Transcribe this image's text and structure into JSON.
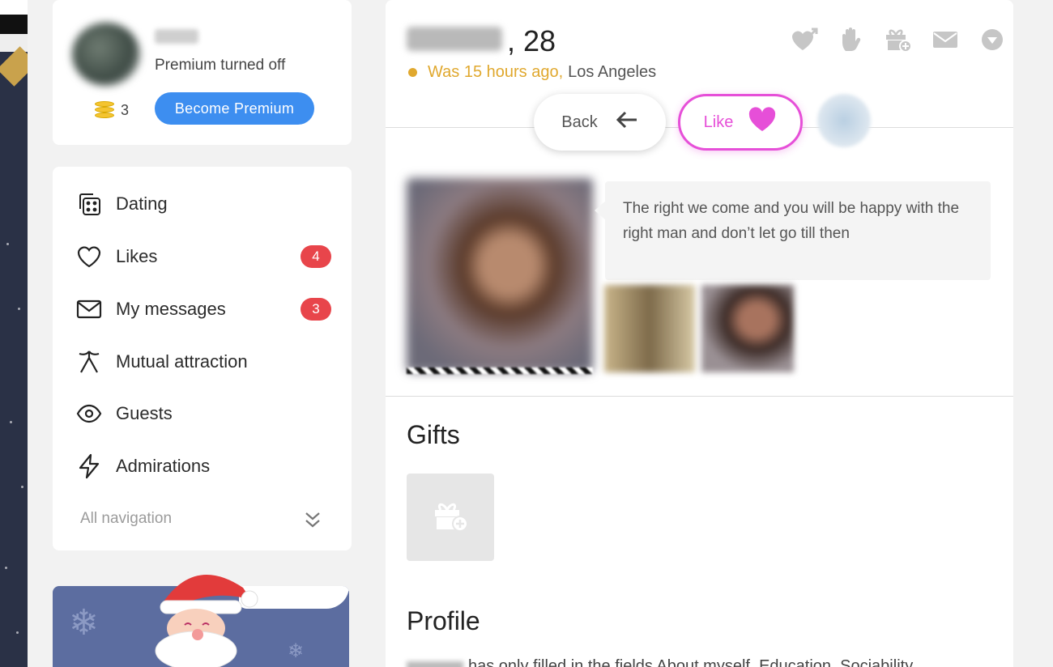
{
  "user": {
    "premium_status": "Premium turned off",
    "coins": "3",
    "become_premium_label": "Become Premium"
  },
  "nav": {
    "items": [
      {
        "label": "Dating",
        "icon": "dating-icon",
        "badge": ""
      },
      {
        "label": "Likes",
        "icon": "heart-icon",
        "badge": "4"
      },
      {
        "label": "My messages",
        "icon": "envelope-icon",
        "badge": "3"
      },
      {
        "label": "Mutual attraction",
        "icon": "mutual-attraction-icon",
        "badge": ""
      },
      {
        "label": "Guests",
        "icon": "eye-icon",
        "badge": ""
      },
      {
        "label": "Admirations",
        "icon": "lightning-icon",
        "badge": ""
      }
    ],
    "all_navigation_label": "All navigation"
  },
  "profile": {
    "age_suffix": ", 28",
    "last_seen": "Was 15 hours ago,",
    "city": "Los Angeles",
    "back_label": "Back",
    "like_label": "Like",
    "bio": "The right we come and you will be happy with the right man and don’t let go till then",
    "gifts_title": "Gifts",
    "profile_title": "Profile",
    "profile_text": "has only filled in the fields About myself, Education, Sociability"
  },
  "colors": {
    "accent_blue": "#3d8ef0",
    "like_pink": "#e64fd8",
    "badge_red": "#e8454b",
    "status_gold": "#e0a82e"
  }
}
